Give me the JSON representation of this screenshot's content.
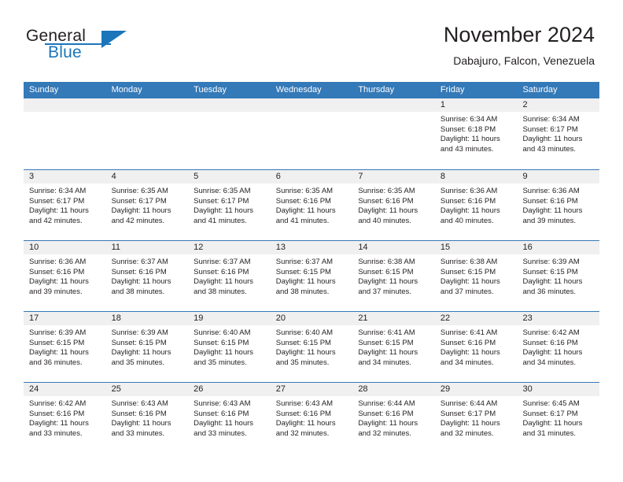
{
  "brand": {
    "name_part1": "General",
    "name_part2": "Blue",
    "logo_icon": "blue-triangle-icon"
  },
  "header": {
    "month_title": "November 2024",
    "location": "Dabajuro, Falcon, Venezuela"
  },
  "theme": {
    "header_blue": "#3479b8",
    "brand_blue": "#1b75bb",
    "day_band_gray": "#f0f0f0",
    "text_dark": "#231f20"
  },
  "weekdays": [
    "Sunday",
    "Monday",
    "Tuesday",
    "Wednesday",
    "Thursday",
    "Friday",
    "Saturday"
  ],
  "weeks": [
    [
      {
        "day": "",
        "empty": true
      },
      {
        "day": "",
        "empty": true
      },
      {
        "day": "",
        "empty": true
      },
      {
        "day": "",
        "empty": true
      },
      {
        "day": "",
        "empty": true
      },
      {
        "day": "1",
        "sunrise": "Sunrise: 6:34 AM",
        "sunset": "Sunset: 6:18 PM",
        "daylight": "Daylight: 11 hours and 43 minutes."
      },
      {
        "day": "2",
        "sunrise": "Sunrise: 6:34 AM",
        "sunset": "Sunset: 6:17 PM",
        "daylight": "Daylight: 11 hours and 43 minutes."
      }
    ],
    [
      {
        "day": "3",
        "sunrise": "Sunrise: 6:34 AM",
        "sunset": "Sunset: 6:17 PM",
        "daylight": "Daylight: 11 hours and 42 minutes."
      },
      {
        "day": "4",
        "sunrise": "Sunrise: 6:35 AM",
        "sunset": "Sunset: 6:17 PM",
        "daylight": "Daylight: 11 hours and 42 minutes."
      },
      {
        "day": "5",
        "sunrise": "Sunrise: 6:35 AM",
        "sunset": "Sunset: 6:17 PM",
        "daylight": "Daylight: 11 hours and 41 minutes."
      },
      {
        "day": "6",
        "sunrise": "Sunrise: 6:35 AM",
        "sunset": "Sunset: 6:16 PM",
        "daylight": "Daylight: 11 hours and 41 minutes."
      },
      {
        "day": "7",
        "sunrise": "Sunrise: 6:35 AM",
        "sunset": "Sunset: 6:16 PM",
        "daylight": "Daylight: 11 hours and 40 minutes."
      },
      {
        "day": "8",
        "sunrise": "Sunrise: 6:36 AM",
        "sunset": "Sunset: 6:16 PM",
        "daylight": "Daylight: 11 hours and 40 minutes."
      },
      {
        "day": "9",
        "sunrise": "Sunrise: 6:36 AM",
        "sunset": "Sunset: 6:16 PM",
        "daylight": "Daylight: 11 hours and 39 minutes."
      }
    ],
    [
      {
        "day": "10",
        "sunrise": "Sunrise: 6:36 AM",
        "sunset": "Sunset: 6:16 PM",
        "daylight": "Daylight: 11 hours and 39 minutes."
      },
      {
        "day": "11",
        "sunrise": "Sunrise: 6:37 AM",
        "sunset": "Sunset: 6:16 PM",
        "daylight": "Daylight: 11 hours and 38 minutes."
      },
      {
        "day": "12",
        "sunrise": "Sunrise: 6:37 AM",
        "sunset": "Sunset: 6:16 PM",
        "daylight": "Daylight: 11 hours and 38 minutes."
      },
      {
        "day": "13",
        "sunrise": "Sunrise: 6:37 AM",
        "sunset": "Sunset: 6:15 PM",
        "daylight": "Daylight: 11 hours and 38 minutes."
      },
      {
        "day": "14",
        "sunrise": "Sunrise: 6:38 AM",
        "sunset": "Sunset: 6:15 PM",
        "daylight": "Daylight: 11 hours and 37 minutes."
      },
      {
        "day": "15",
        "sunrise": "Sunrise: 6:38 AM",
        "sunset": "Sunset: 6:15 PM",
        "daylight": "Daylight: 11 hours and 37 minutes."
      },
      {
        "day": "16",
        "sunrise": "Sunrise: 6:39 AM",
        "sunset": "Sunset: 6:15 PM",
        "daylight": "Daylight: 11 hours and 36 minutes."
      }
    ],
    [
      {
        "day": "17",
        "sunrise": "Sunrise: 6:39 AM",
        "sunset": "Sunset: 6:15 PM",
        "daylight": "Daylight: 11 hours and 36 minutes."
      },
      {
        "day": "18",
        "sunrise": "Sunrise: 6:39 AM",
        "sunset": "Sunset: 6:15 PM",
        "daylight": "Daylight: 11 hours and 35 minutes."
      },
      {
        "day": "19",
        "sunrise": "Sunrise: 6:40 AM",
        "sunset": "Sunset: 6:15 PM",
        "daylight": "Daylight: 11 hours and 35 minutes."
      },
      {
        "day": "20",
        "sunrise": "Sunrise: 6:40 AM",
        "sunset": "Sunset: 6:15 PM",
        "daylight": "Daylight: 11 hours and 35 minutes."
      },
      {
        "day": "21",
        "sunrise": "Sunrise: 6:41 AM",
        "sunset": "Sunset: 6:15 PM",
        "daylight": "Daylight: 11 hours and 34 minutes."
      },
      {
        "day": "22",
        "sunrise": "Sunrise: 6:41 AM",
        "sunset": "Sunset: 6:16 PM",
        "daylight": "Daylight: 11 hours and 34 minutes."
      },
      {
        "day": "23",
        "sunrise": "Sunrise: 6:42 AM",
        "sunset": "Sunset: 6:16 PM",
        "daylight": "Daylight: 11 hours and 34 minutes."
      }
    ],
    [
      {
        "day": "24",
        "sunrise": "Sunrise: 6:42 AM",
        "sunset": "Sunset: 6:16 PM",
        "daylight": "Daylight: 11 hours and 33 minutes."
      },
      {
        "day": "25",
        "sunrise": "Sunrise: 6:43 AM",
        "sunset": "Sunset: 6:16 PM",
        "daylight": "Daylight: 11 hours and 33 minutes."
      },
      {
        "day": "26",
        "sunrise": "Sunrise: 6:43 AM",
        "sunset": "Sunset: 6:16 PM",
        "daylight": "Daylight: 11 hours and 33 minutes."
      },
      {
        "day": "27",
        "sunrise": "Sunrise: 6:43 AM",
        "sunset": "Sunset: 6:16 PM",
        "daylight": "Daylight: 11 hours and 32 minutes."
      },
      {
        "day": "28",
        "sunrise": "Sunrise: 6:44 AM",
        "sunset": "Sunset: 6:16 PM",
        "daylight": "Daylight: 11 hours and 32 minutes."
      },
      {
        "day": "29",
        "sunrise": "Sunrise: 6:44 AM",
        "sunset": "Sunset: 6:17 PM",
        "daylight": "Daylight: 11 hours and 32 minutes."
      },
      {
        "day": "30",
        "sunrise": "Sunrise: 6:45 AM",
        "sunset": "Sunset: 6:17 PM",
        "daylight": "Daylight: 11 hours and 31 minutes."
      }
    ]
  ]
}
